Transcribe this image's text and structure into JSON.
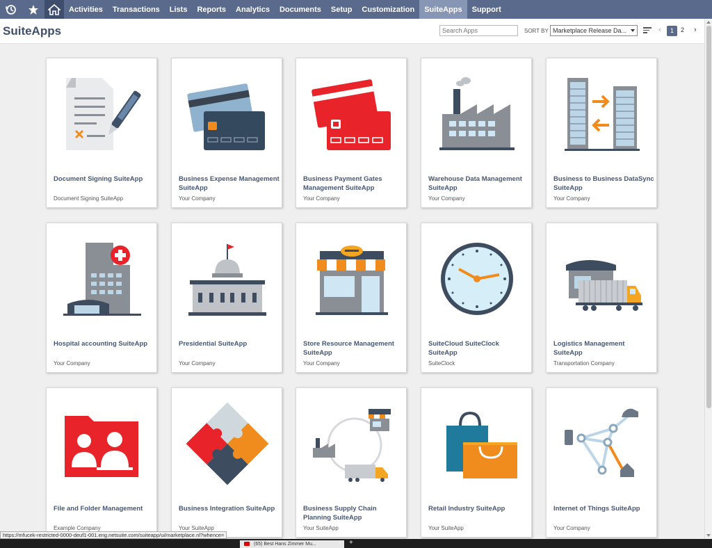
{
  "nav": {
    "items": [
      {
        "label": "Activities",
        "active": false
      },
      {
        "label": "Transactions",
        "active": false
      },
      {
        "label": "Lists",
        "active": false
      },
      {
        "label": "Reports",
        "active": false
      },
      {
        "label": "Analytics",
        "active": false
      },
      {
        "label": "Documents",
        "active": false
      },
      {
        "label": "Setup",
        "active": false
      },
      {
        "label": "Customization",
        "active": false
      },
      {
        "label": "SuiteApps",
        "active": true
      },
      {
        "label": "Support",
        "active": false
      }
    ],
    "icons": [
      "recent-records-icon",
      "star-icon",
      "home-icon"
    ]
  },
  "header": {
    "title": "SuiteApps",
    "search_placeholder": "Search Apps",
    "sort_label": "SORT BY",
    "sort_value": "Marketplace Release Da...",
    "pagination": {
      "current": "1",
      "next": "2"
    }
  },
  "tiles": [
    {
      "name": "Document Signing SuiteApp",
      "company": "Document Signing SuiteApp",
      "icon": "document-signing-icon"
    },
    {
      "name": "Business Expense Management SuiteApp",
      "company": "Your Company",
      "icon": "credit-cards-icon"
    },
    {
      "name": "Business Payment Gates Management SuiteApp",
      "company": "Your Company",
      "icon": "payment-cards-icon"
    },
    {
      "name": "Warehouse Data Management SuiteApp",
      "company": "Your Company",
      "icon": "factory-icon"
    },
    {
      "name": "Business to Business DataSync SuiteApp",
      "company": "Your Company",
      "icon": "buildings-sync-icon"
    },
    {
      "name": "Hospital accounting SuiteApp",
      "company": "Your Company",
      "icon": "hospital-icon"
    },
    {
      "name": "Presidential SuiteApp",
      "company": "Your Company",
      "icon": "capitol-building-icon"
    },
    {
      "name": "Store Resource Management SuiteApp",
      "company": "Your Company",
      "icon": "storefront-icon"
    },
    {
      "name": "SuiteCloud SuiteClock SuiteApp",
      "company": "SuiteClock",
      "icon": "clock-icon"
    },
    {
      "name": "Logistics Management SuiteApp",
      "company": "Transportation Company",
      "icon": "truck-warehouse-icon"
    },
    {
      "name": "File and Folder Management",
      "company": "Example Company",
      "icon": "folder-users-icon"
    },
    {
      "name": "Business Integration SuiteApp",
      "company": "Your SuiteApp",
      "icon": "puzzle-icon"
    },
    {
      "name": "Business Supply Chain Planning SuiteApp",
      "company": "Your SuiteApp",
      "icon": "supply-chain-icon"
    },
    {
      "name": "Retail Industry SuiteApp",
      "company": "Your SuiteApp",
      "icon": "shopping-bags-icon"
    },
    {
      "name": "Internet of Things SuiteApp",
      "company": "Your Company",
      "icon": "iot-network-icon"
    }
  ],
  "status_url": "https://mfucek-restricted-0000-deuf1-001.eng.netsuite.com/suiteapp/ui/marketplace.nl?whence=",
  "taskbar_tab": "(65) Best Hans Zimmer Mu..."
}
